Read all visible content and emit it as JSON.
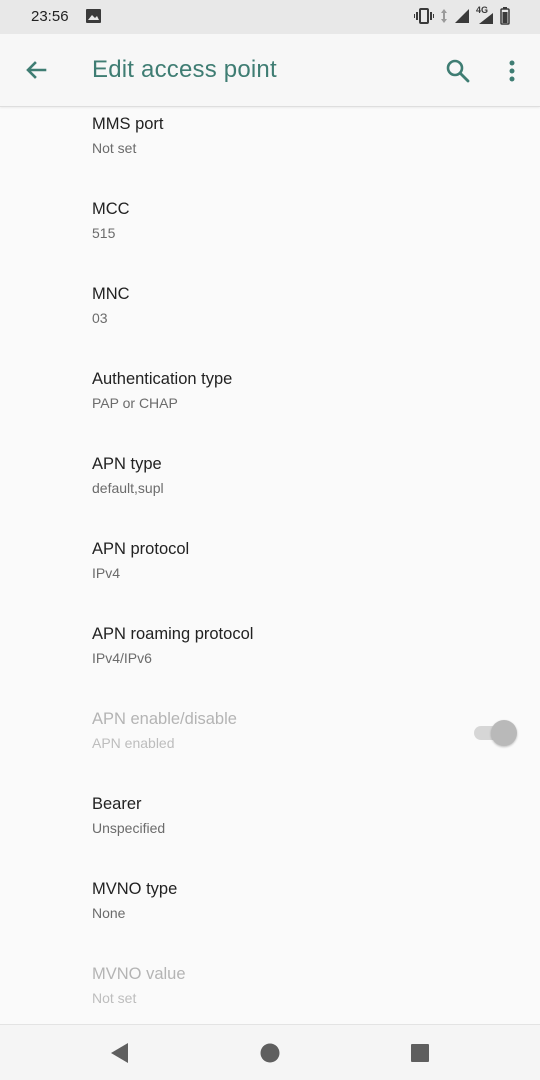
{
  "status_bar": {
    "time": "23:56",
    "network_label": "4G",
    "icons": [
      "image-icon",
      "vibrate-icon",
      "data-arrows-icon",
      "signal-icon",
      "signal-4g-icon",
      "battery-icon"
    ]
  },
  "app_bar": {
    "title": "Edit access point",
    "back_icon": "arrow-back-icon",
    "search_icon": "search-icon",
    "more_icon": "more-vert-icon",
    "accent_color": "#3f7d73"
  },
  "preferences": [
    {
      "title": "MMS port",
      "summary": "Not set",
      "enabled": true
    },
    {
      "title": "MCC",
      "summary": "515",
      "enabled": true
    },
    {
      "title": "MNC",
      "summary": "03",
      "enabled": true
    },
    {
      "title": "Authentication type",
      "summary": "PAP or CHAP",
      "enabled": true
    },
    {
      "title": "APN type",
      "summary": "default,supl",
      "enabled": true
    },
    {
      "title": "APN protocol",
      "summary": "IPv4",
      "enabled": true
    },
    {
      "title": "APN roaming protocol",
      "summary": "IPv4/IPv6",
      "enabled": true
    },
    {
      "title": "APN enable/disable",
      "summary": "APN enabled",
      "enabled": false,
      "toggle_on": true
    },
    {
      "title": "Bearer",
      "summary": "Unspecified",
      "enabled": true
    },
    {
      "title": "MVNO type",
      "summary": "None",
      "enabled": true
    },
    {
      "title": "MVNO value",
      "summary": "Not set",
      "enabled": false
    }
  ],
  "nav_bar": {
    "icons": [
      "nav-back-icon",
      "nav-home-icon",
      "nav-recents-icon"
    ]
  }
}
